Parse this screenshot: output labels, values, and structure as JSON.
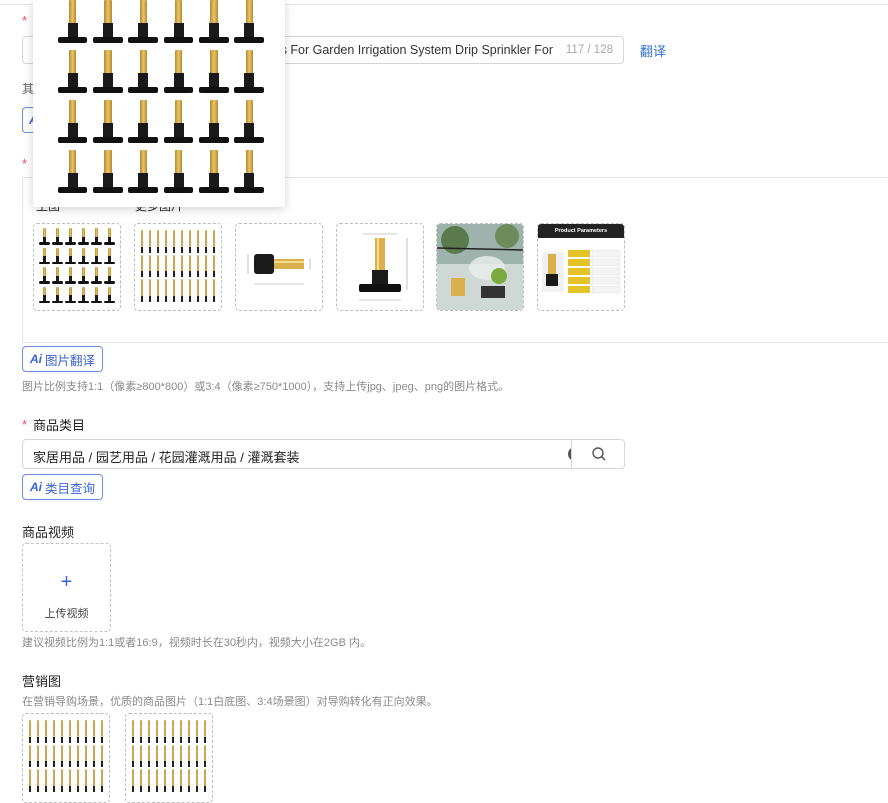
{
  "title_field": {
    "required_mark": "*",
    "value_visible": "s For Garden Irrigation System Drip Sprinkler For",
    "counter": "117 / 128",
    "translate_label": "翻译"
  },
  "title_help_prefix": "其",
  "ai_badge": "Ai",
  "image_section": {
    "required_mark": "*",
    "main_image_label": "主图",
    "more_images_label": "更多图片",
    "translate_button": "图片翻译",
    "help": "图片比例支持1:1（像素≥800*800）或3:4（像素≥750*1000），支持上传jpg、jpeg、png的图片格式。",
    "thumbnails": [
      {
        "kind": "sprinkler-grid-black"
      },
      {
        "kind": "sprinkler-grid-gold"
      },
      {
        "kind": "sprinkler-dimensions-side"
      },
      {
        "kind": "sprinkler-dimensions-front"
      },
      {
        "kind": "garden-misting-photo"
      },
      {
        "kind": "product-parameters",
        "caption": "Product Parameters"
      }
    ]
  },
  "category": {
    "required_mark": "*",
    "label": "商品类目",
    "value": "家居用品 / 园艺用品 / 花园灌溉用品 / 灌溉套装",
    "query_button": "类目查询"
  },
  "video": {
    "label": "商品视频",
    "upload_plus": "+",
    "upload_text": "上传视频",
    "help": "建议视频比例为1:1或者16:9，视频时长在30秒内，视频大小在2GB 内。"
  },
  "marketing": {
    "label": "营销图",
    "help": "在营销导购场景，优质的商品图片（1:1白底图、3:4场景图）对导购转化有正向效果。"
  },
  "colors": {
    "accent": "#3a63d6",
    "required": "#e34d59",
    "border": "#d6d6d6"
  }
}
